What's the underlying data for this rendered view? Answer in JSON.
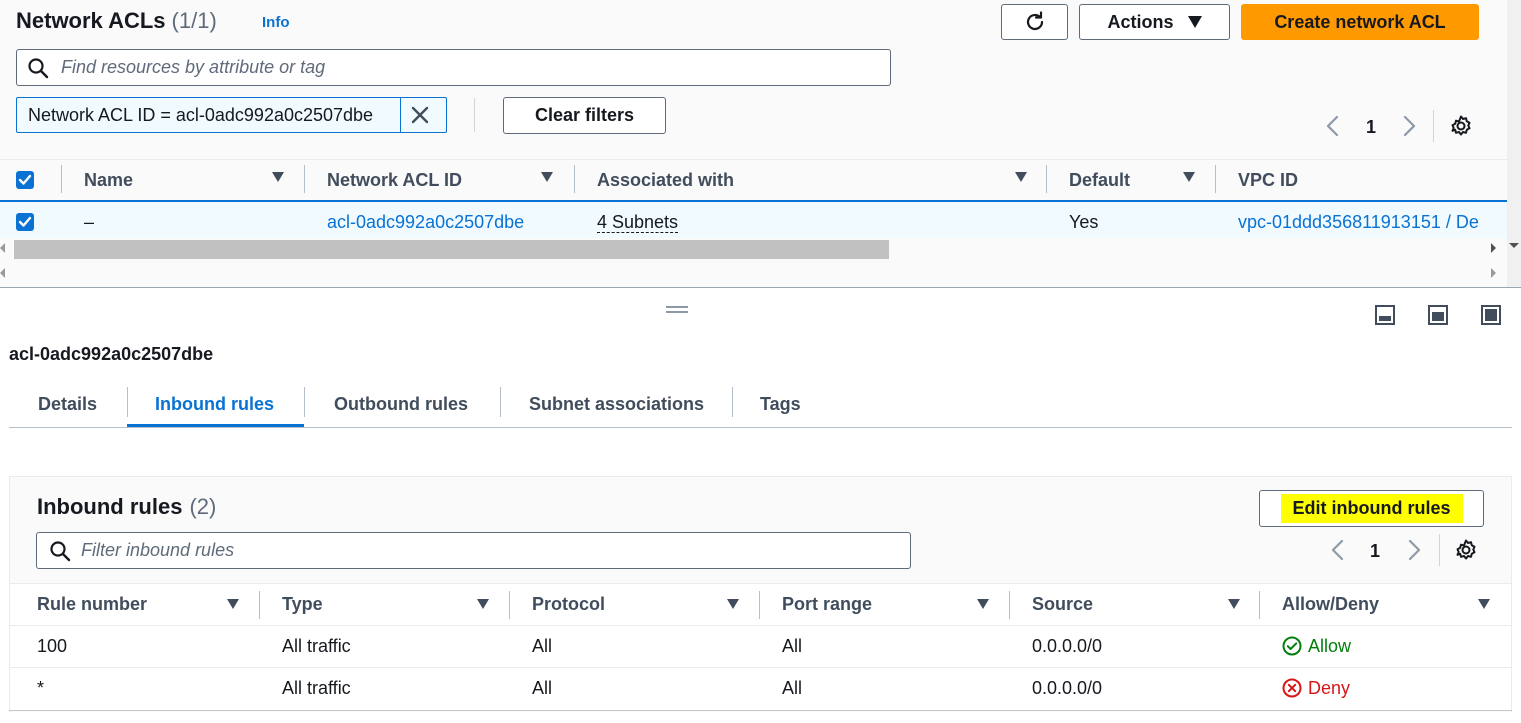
{
  "header": {
    "title": "Network ACLs",
    "count": "(1/1)",
    "info": "Info",
    "actions_label": "Actions",
    "create_label": "Create network ACL"
  },
  "search": {
    "placeholder": "Find resources by attribute or tag"
  },
  "filter": {
    "token_label": "Network ACL ID = acl-0adc992a0c2507dbe",
    "clear_label": "Clear filters"
  },
  "pagination": {
    "page": "1"
  },
  "table": {
    "columns": [
      "Name",
      "Network ACL ID",
      "Associated with",
      "Default",
      "VPC ID"
    ],
    "rows": [
      {
        "name": "–",
        "acl_id": "acl-0adc992a0c2507dbe",
        "associated": "4 Subnets",
        "default": "Yes",
        "vpc": "vpc-01ddd356811913151 / De"
      }
    ]
  },
  "detail": {
    "title": "acl-0adc992a0c2507dbe",
    "tabs": [
      "Details",
      "Inbound rules",
      "Outbound rules",
      "Subnet associations",
      "Tags"
    ],
    "active_tab": "Inbound rules"
  },
  "inbound": {
    "title": "Inbound rules",
    "count": "(2)",
    "edit_label": "Edit inbound rules",
    "filter_placeholder": "Filter inbound rules",
    "page": "1",
    "columns": [
      "Rule number",
      "Type",
      "Protocol",
      "Port range",
      "Source",
      "Allow/Deny"
    ],
    "rows": [
      {
        "rule": "100",
        "type": "All traffic",
        "protocol": "All",
        "port": "All",
        "source": "0.0.0.0/0",
        "action": "Allow"
      },
      {
        "rule": "*",
        "type": "All traffic",
        "protocol": "All",
        "port": "All",
        "source": "0.0.0.0/0",
        "action": "Deny"
      }
    ]
  },
  "colors": {
    "link": "#0972d3",
    "primary": "#ff9900",
    "allow": "#037f0c",
    "deny": "#d91515",
    "highlight": "#ffff00"
  },
  "icons": [
    "refresh-icon",
    "caret-down-icon",
    "search-icon",
    "close-icon",
    "chevron-left-icon",
    "chevron-right-icon",
    "settings-icon",
    "check-icon",
    "drag-handle-icon",
    "panel-bottom-icon",
    "panel-side-icon",
    "panel-full-icon",
    "check-circle-icon",
    "x-circle-icon"
  ]
}
